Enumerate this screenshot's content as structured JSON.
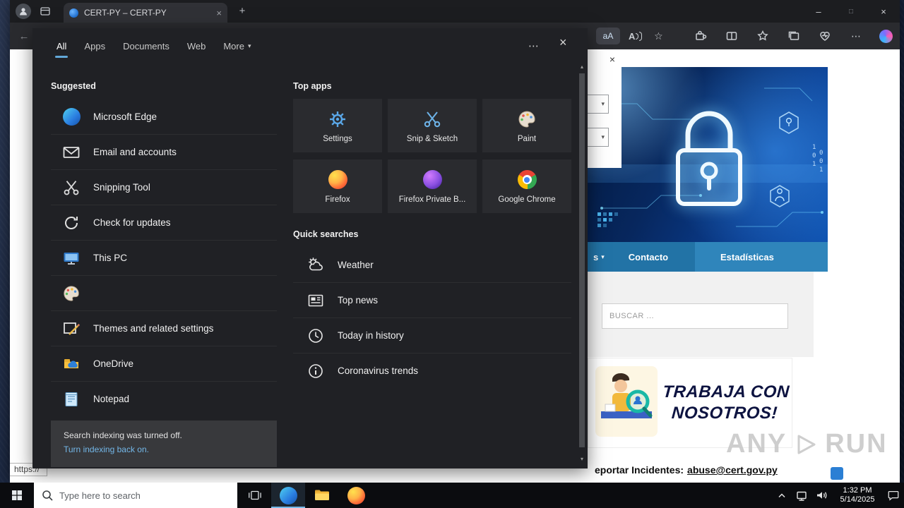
{
  "browser": {
    "tab": {
      "title": "CERT-PY – CERT-PY"
    },
    "status_tooltip": "https://",
    "page": {
      "nav": {
        "item_servicios": "s",
        "item_contacto": "Contacto",
        "item_estadisticas": "Estadísticas"
      },
      "search_placeholder": "BUSCAR ...",
      "banner": {
        "line1": "TRABAJA CON",
        "line2": "NOSOTROS!"
      },
      "footer": {
        "label": "eportar Incidentes:",
        "email": "abuse@cert.gov.py"
      },
      "watermark": {
        "left": "ANY",
        "right": "RUN"
      }
    }
  },
  "flyout": {
    "tabs": {
      "all": "All",
      "apps": "Apps",
      "documents": "Documents",
      "web": "Web",
      "more": "More"
    },
    "suggested": {
      "heading": "Suggested",
      "items": [
        {
          "label": "Microsoft Edge",
          "icon": "edge-icon"
        },
        {
          "label": "Email and accounts",
          "icon": "email-icon"
        },
        {
          "label": "Snipping Tool",
          "icon": "scissors-icon"
        },
        {
          "label": "Check for updates",
          "icon": "refresh-icon"
        },
        {
          "label": "This PC",
          "icon": "computer-icon"
        },
        {
          "label": "Paint",
          "icon": "palette-icon"
        },
        {
          "label": "Themes and related settings",
          "icon": "themes-icon"
        },
        {
          "label": "OneDrive",
          "icon": "onedrive-icon"
        },
        {
          "label": "Notepad",
          "icon": "notepad-icon"
        }
      ]
    },
    "top_apps": {
      "heading": "Top apps",
      "tiles": [
        {
          "label": "Settings",
          "icon": "gear-icon"
        },
        {
          "label": "Snip & Sketch",
          "icon": "scissors-icon"
        },
        {
          "label": "Paint",
          "icon": "palette-icon"
        },
        {
          "label": "Firefox",
          "icon": "firefox-icon"
        },
        {
          "label": "Firefox Private B...",
          "icon": "firefox-private-icon"
        },
        {
          "label": "Google Chrome",
          "icon": "chrome-icon"
        }
      ]
    },
    "quick_searches": {
      "heading": "Quick searches",
      "items": [
        {
          "label": "Weather",
          "icon": "weather-icon"
        },
        {
          "label": "Top news",
          "icon": "news-icon"
        },
        {
          "label": "Today in history",
          "icon": "clock-icon"
        },
        {
          "label": "Coronavirus trends",
          "icon": "info-icon"
        }
      ]
    },
    "notice": {
      "message": "Search indexing was turned off.",
      "link": "Turn indexing back on."
    }
  },
  "taskbar": {
    "search_placeholder": "Type here to search",
    "clock_time": "1:32 PM",
    "clock_date": "5/14/2025"
  },
  "glyphs": {
    "close": "×",
    "minimize": "–",
    "maximize": "□",
    "plus": "+",
    "back": "←",
    "chevron_down": "▾",
    "scroll_up": "▴",
    "scroll_down": "▾",
    "ellipsis": "⋯",
    "star": "☆",
    "translate": "aA",
    "read_aloud": "A"
  },
  "colors": {
    "accent": "#62a8d8",
    "flyout_bg": "#202125",
    "nav_blue": "#2273a6",
    "nav_active_blue": "#2f85bb",
    "link_blue": "#73b7e8",
    "taskbar_bg": "#0b0c0f"
  }
}
